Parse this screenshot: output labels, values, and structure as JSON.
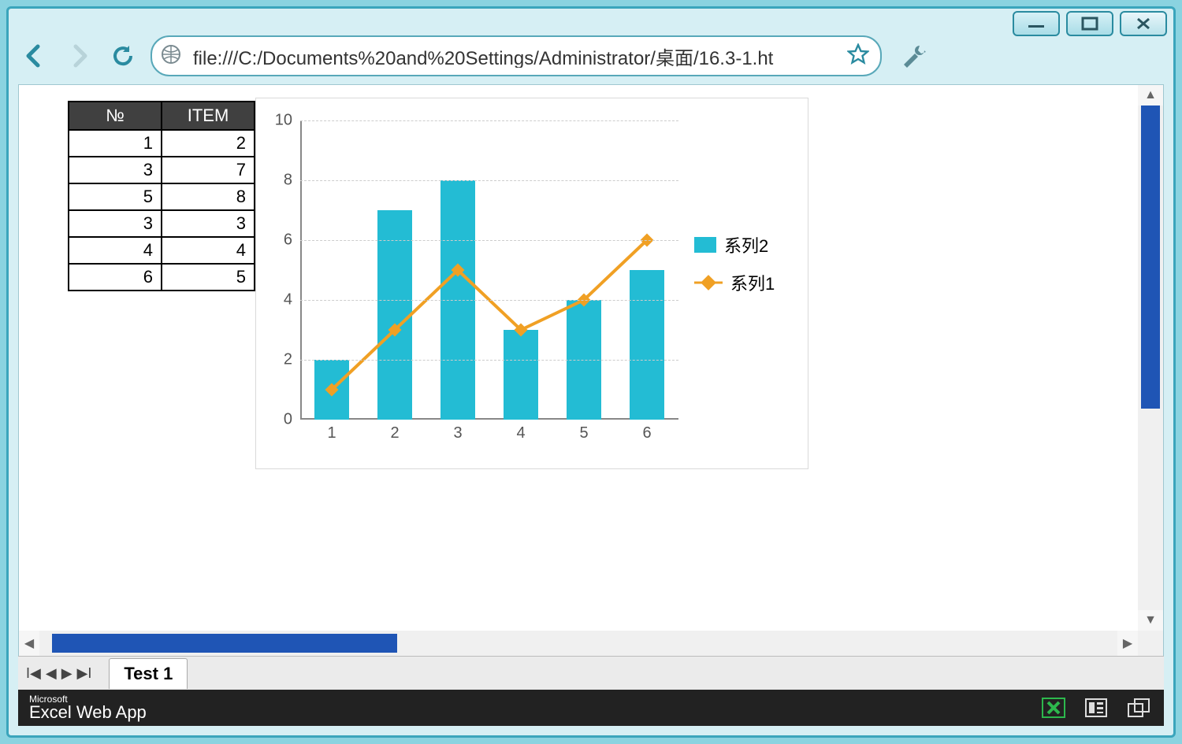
{
  "window_controls": {
    "minimize": "minimize",
    "maximize": "maximize",
    "close": "close"
  },
  "address_bar": {
    "url": "file:///C:/Documents%20and%20Settings/Administrator/桌面/16.3-1.ht"
  },
  "table": {
    "headers": [
      "№",
      "ITEM"
    ],
    "rows": [
      [
        1,
        2
      ],
      [
        3,
        7
      ],
      [
        5,
        8
      ],
      [
        3,
        3
      ],
      [
        4,
        4
      ],
      [
        6,
        5
      ]
    ]
  },
  "chart_data": {
    "type": "bar",
    "categories": [
      "1",
      "2",
      "3",
      "4",
      "5",
      "6"
    ],
    "series": [
      {
        "name": "系列2",
        "kind": "bar",
        "values": [
          2,
          7,
          8,
          3,
          4,
          5
        ],
        "color": "#23bcd4"
      },
      {
        "name": "系列1",
        "kind": "line",
        "values": [
          1,
          3,
          5,
          3,
          4,
          6
        ],
        "color": "#f0a024"
      }
    ],
    "yticks": [
      0,
      2,
      4,
      6,
      8,
      10
    ],
    "ylim": [
      0,
      10
    ]
  },
  "sheet": {
    "tab": "Test 1"
  },
  "appbar": {
    "vendor": "Microsoft",
    "name": "Excel Web App"
  },
  "icons": {
    "back": "back-icon",
    "forward": "forward-icon",
    "reload": "reload-icon",
    "globe": "globe-icon",
    "star": "star-icon",
    "wrench": "wrench-icon",
    "excel": "excel-icon",
    "reading": "reading-view-icon",
    "popout": "popout-icon"
  }
}
